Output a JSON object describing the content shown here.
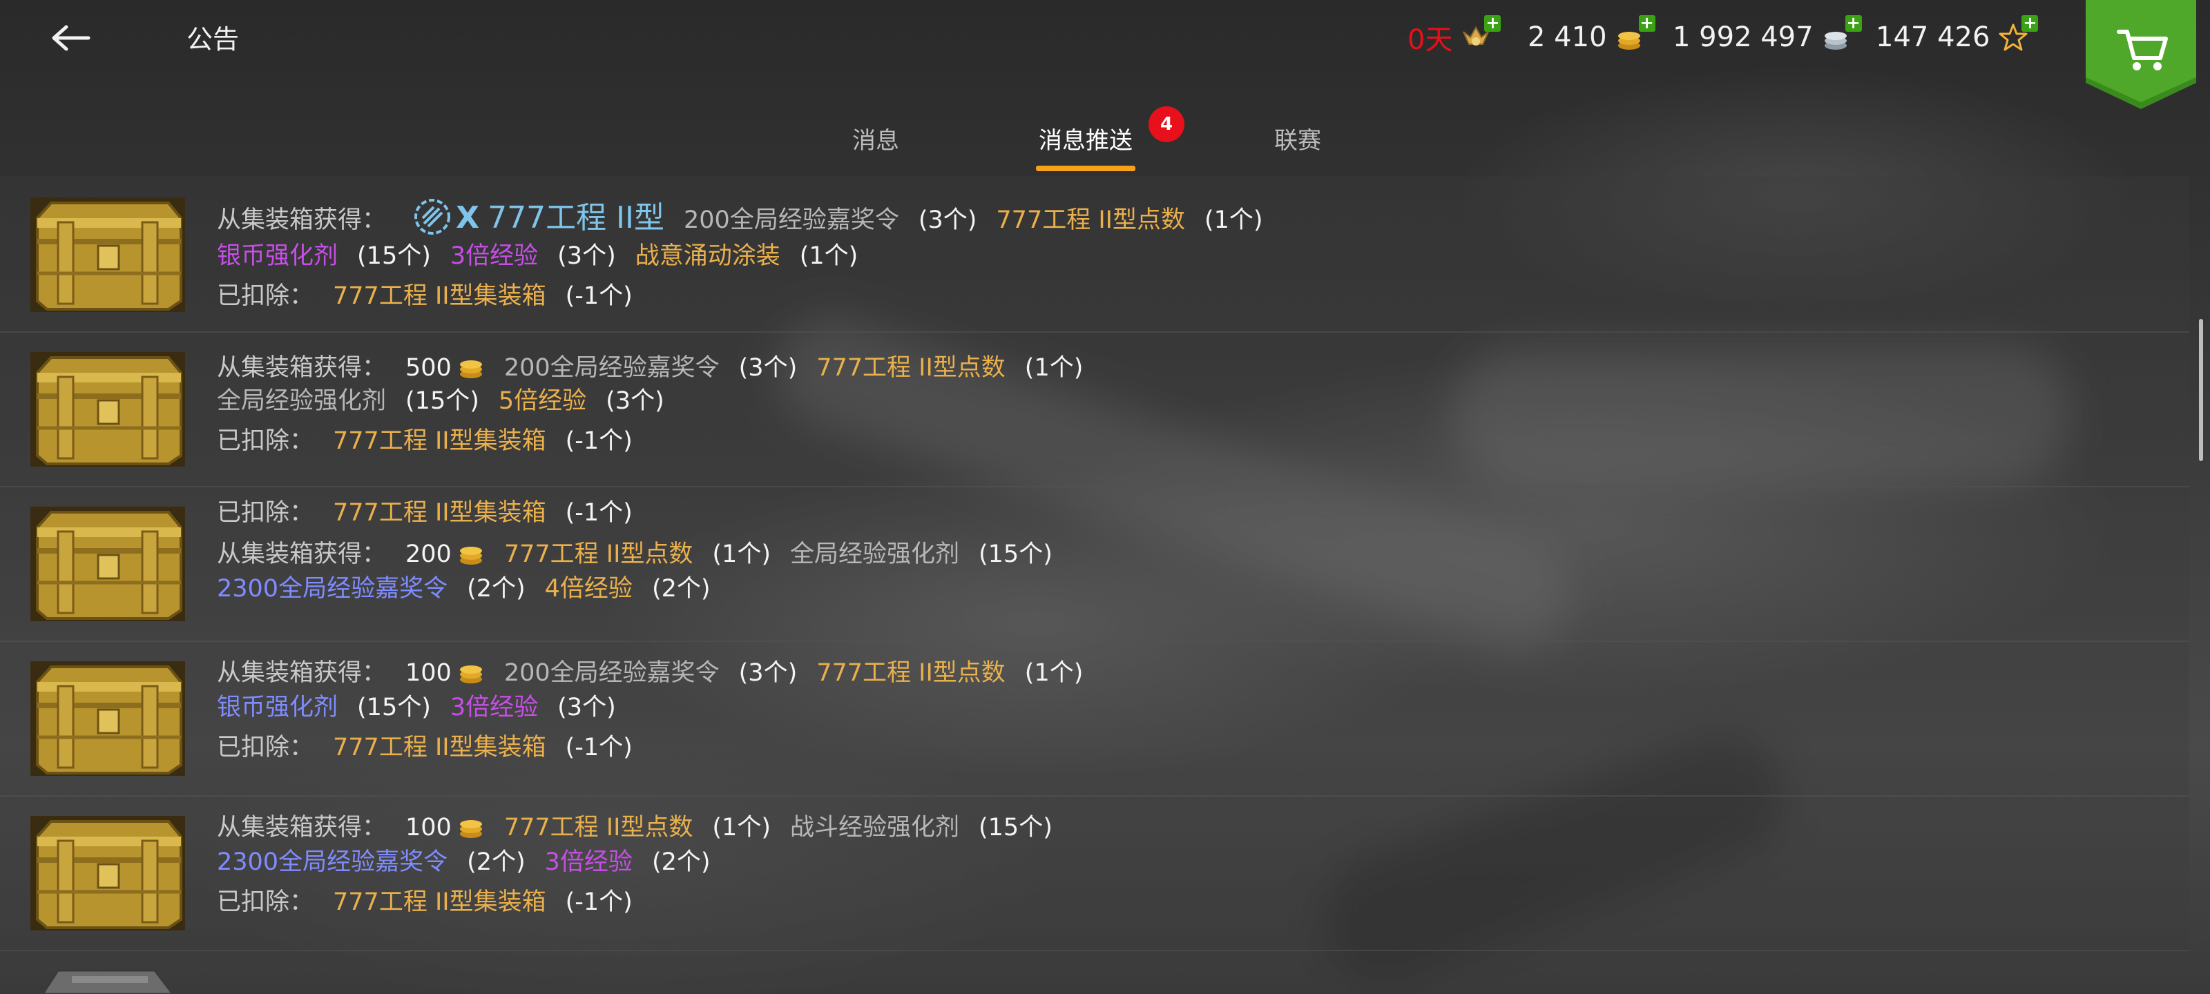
{
  "header": {
    "title": "公告",
    "currencies": [
      {
        "value": "0天",
        "color": "#e8101a",
        "icon": "premium-account-icon"
      },
      {
        "value": "2 410",
        "color": "#f2f2f2",
        "icon": "gold-coins-icon"
      },
      {
        "value": "1 992 497",
        "color": "#f2f2f2",
        "icon": "silver-coins-icon"
      },
      {
        "value": "147 426",
        "color": "#f2f2f2",
        "icon": "free-xp-star-icon"
      }
    ],
    "plus": "+"
  },
  "tabs": [
    {
      "label": "消息"
    },
    {
      "label": "消息推送",
      "badge": "4",
      "active": true
    },
    {
      "label": "联赛"
    }
  ],
  "rows": [
    {
      "lines": [
        [
          {
            "text": "从集装箱获得：",
            "style": "lbl"
          },
          {
            "text": "X",
            "style": "tier-blue"
          },
          {
            "text": "777工程 II型",
            "style": "tier-blue"
          },
          {
            "text": "200全局经验嘉奖令",
            "style": "grey"
          },
          {
            "text": "(3个)",
            "style": "num"
          },
          {
            "text": "777工程 II型点数",
            "style": "gold"
          },
          {
            "text": "(1个)",
            "style": "num"
          }
        ],
        [
          {
            "text": "银币强化剂",
            "style": "purple"
          },
          {
            "text": "(15个)",
            "style": "num"
          },
          {
            "text": "3倍经验",
            "style": "purple"
          },
          {
            "text": "(3个)",
            "style": "num"
          },
          {
            "text": "战意涌动涂装",
            "style": "gold"
          },
          {
            "text": "(1个)",
            "style": "num"
          }
        ],
        [
          {
            "text": "已扣除：",
            "style": "lbl"
          },
          {
            "text": "777工程 II型集装箱",
            "style": "gold"
          },
          {
            "text": "(-1个)",
            "style": "num"
          }
        ]
      ]
    },
    {
      "lines": [
        [
          {
            "text": "从集装箱获得：",
            "style": "lbl"
          },
          {
            "text": "500",
            "style": "num",
            "coin": true
          },
          {
            "text": "200全局经验嘉奖令",
            "style": "grey"
          },
          {
            "text": "(3个)",
            "style": "num"
          },
          {
            "text": "777工程 II型点数",
            "style": "gold"
          },
          {
            "text": "(1个)",
            "style": "num"
          }
        ],
        [
          {
            "text": "全局经验强化剂",
            "style": "grey"
          },
          {
            "text": "(15个)",
            "style": "num"
          },
          {
            "text": "5倍经验",
            "style": "gold"
          },
          {
            "text": "(3个)",
            "style": "num"
          }
        ],
        [
          {
            "text": "已扣除：",
            "style": "lbl"
          },
          {
            "text": "777工程 II型集装箱",
            "style": "gold"
          },
          {
            "text": "(-1个)",
            "style": "num"
          }
        ]
      ]
    },
    {
      "lines": [
        [
          {
            "text": "已扣除：",
            "style": "lbl"
          },
          {
            "text": "777工程 II型集装箱",
            "style": "gold"
          },
          {
            "text": "(-1个)",
            "style": "num"
          }
        ],
        [
          {
            "text": "从集装箱获得：",
            "style": "lbl"
          },
          {
            "text": "200",
            "style": "num",
            "coin": true
          },
          {
            "text": "777工程 II型点数",
            "style": "gold"
          },
          {
            "text": "(1个)",
            "style": "num"
          },
          {
            "text": "全局经验强化剂",
            "style": "grey"
          },
          {
            "text": "(15个)",
            "style": "num"
          }
        ],
        [
          {
            "text": "2300全局经验嘉奖令",
            "style": "blue"
          },
          {
            "text": "(2个)",
            "style": "num"
          },
          {
            "text": "4倍经验",
            "style": "gold"
          },
          {
            "text": "(2个)",
            "style": "num"
          }
        ]
      ]
    },
    {
      "lines": [
        [
          {
            "text": "从集装箱获得：",
            "style": "lbl"
          },
          {
            "text": "100",
            "style": "num",
            "coin": true
          },
          {
            "text": "200全局经验嘉奖令",
            "style": "grey"
          },
          {
            "text": "(3个)",
            "style": "num"
          },
          {
            "text": "777工程 II型点数",
            "style": "gold"
          },
          {
            "text": "(1个)",
            "style": "num"
          }
        ],
        [
          {
            "text": "银币强化剂",
            "style": "blue"
          },
          {
            "text": "(15个)",
            "style": "num"
          },
          {
            "text": "3倍经验",
            "style": "purple"
          },
          {
            "text": "(3个)",
            "style": "num"
          }
        ],
        [
          {
            "text": "已扣除：",
            "style": "lbl"
          },
          {
            "text": "777工程 II型集装箱",
            "style": "gold"
          },
          {
            "text": "(-1个)",
            "style": "num"
          }
        ]
      ]
    },
    {
      "lines": [
        [
          {
            "text": "从集装箱获得：",
            "style": "lbl"
          },
          {
            "text": "100",
            "style": "num",
            "coin": true
          },
          {
            "text": "777工程 II型点数",
            "style": "gold"
          },
          {
            "text": "(1个)",
            "style": "num"
          },
          {
            "text": "战斗经验强化剂",
            "style": "grey"
          },
          {
            "text": "(15个)",
            "style": "num"
          }
        ],
        [
          {
            "text": "2300全局经验嘉奖令",
            "style": "blue"
          },
          {
            "text": "(2个)",
            "style": "num"
          },
          {
            "text": "3倍经验",
            "style": "purple"
          },
          {
            "text": "(2个)",
            "style": "num"
          }
        ],
        [
          {
            "text": "已扣除：",
            "style": "lbl"
          },
          {
            "text": "777工程 II型集装箱",
            "style": "gold"
          },
          {
            "text": "(-1个)",
            "style": "num"
          }
        ]
      ]
    }
  ]
}
